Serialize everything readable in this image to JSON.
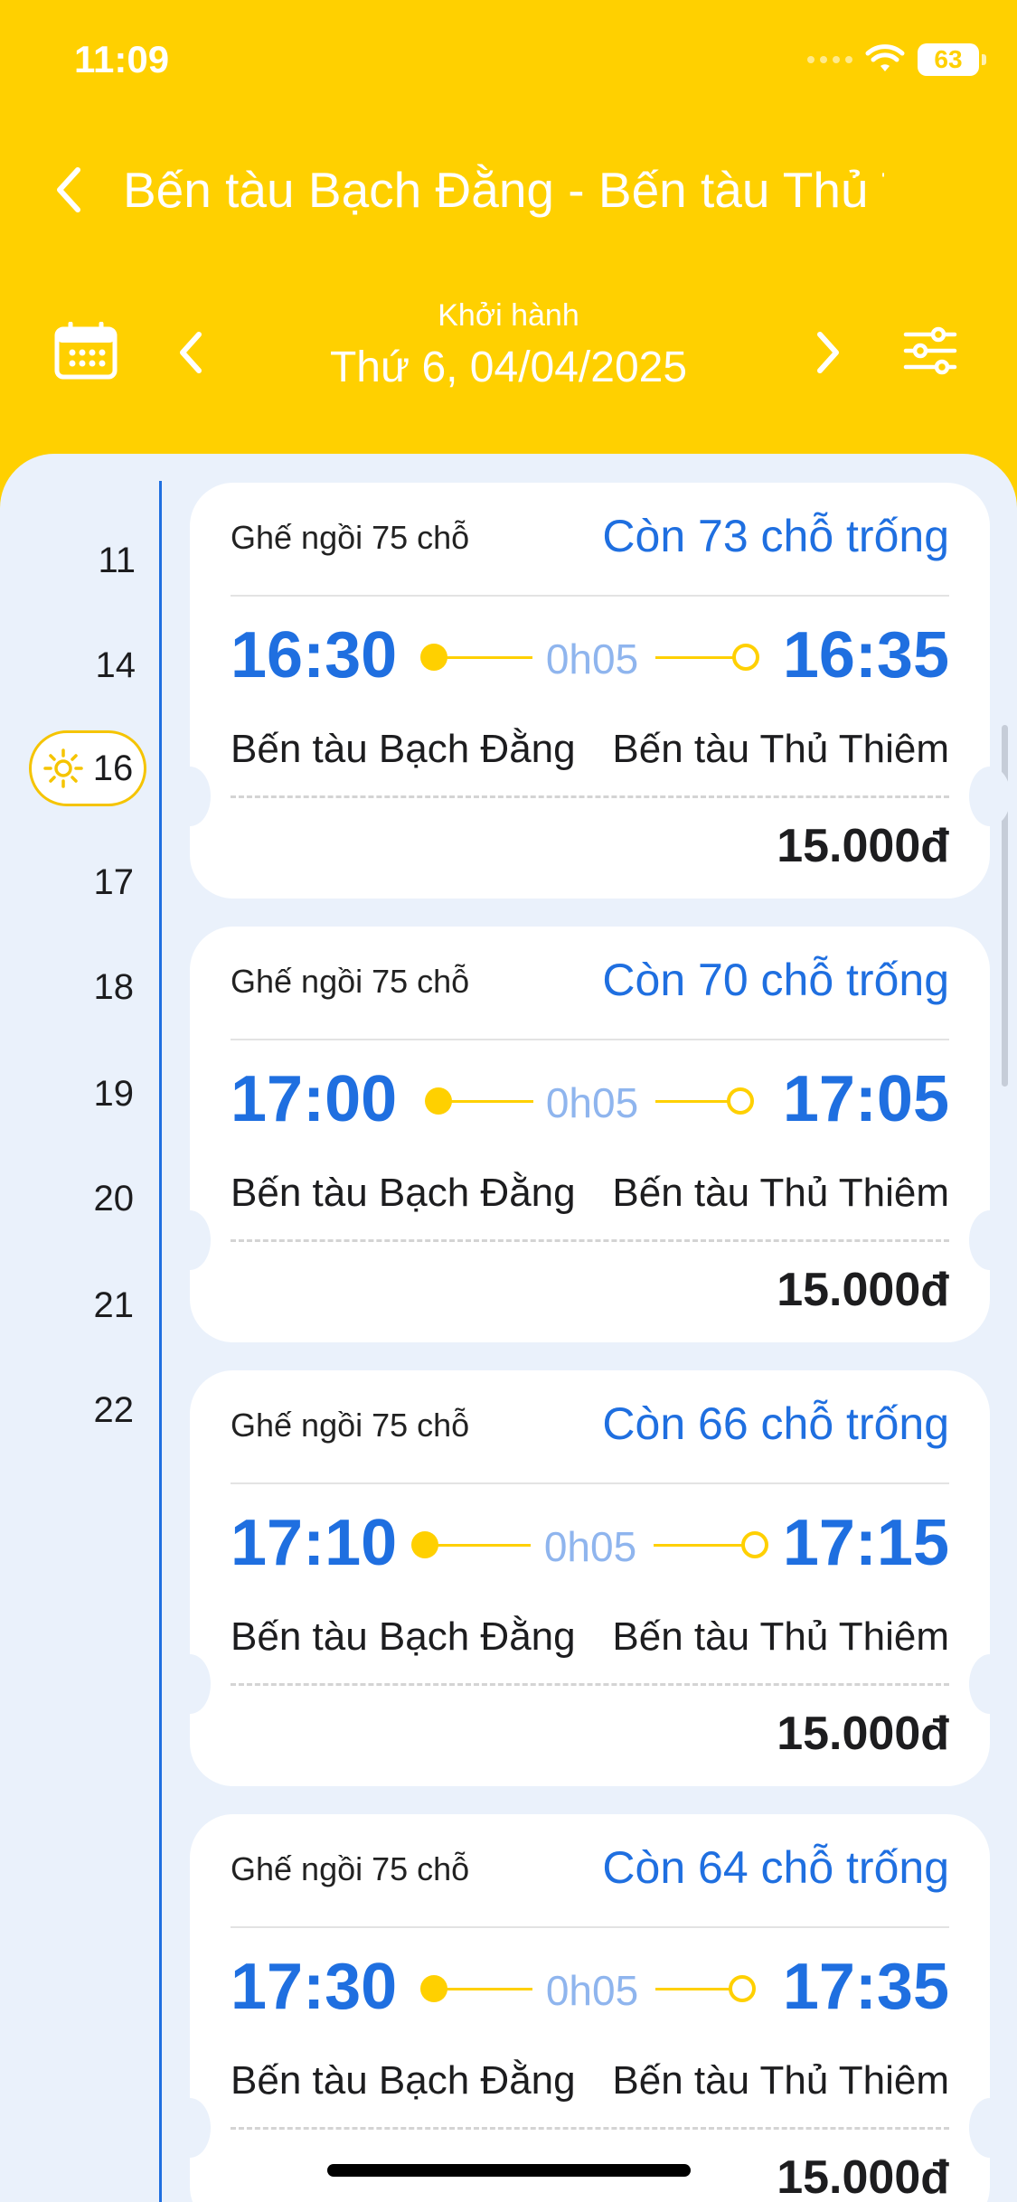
{
  "status_bar": {
    "time": "11:09",
    "battery": "63"
  },
  "header": {
    "title": "Bến tàu Bạch Đằng - Bến tàu Thủ Thiêm"
  },
  "date_nav": {
    "caption": "Khởi hành",
    "date": "Thứ 6, 04/04/2025"
  },
  "timeline": {
    "hours": [
      "11",
      "14",
      "16",
      "17",
      "18",
      "19",
      "20",
      "21",
      "22"
    ],
    "active_hour": "16"
  },
  "trips": [
    {
      "seat_type": "Ghế ngồi 75 chỗ",
      "availability": "Còn 73 chỗ trống",
      "depart": "16:30",
      "arrive": "16:35",
      "duration": "0h05",
      "from": "Bến tàu Bạch Đằng",
      "to": "Bến tàu Thủ Thiêm",
      "price": "15.000đ"
    },
    {
      "seat_type": "Ghế ngồi 75 chỗ",
      "availability": "Còn 70 chỗ trống",
      "depart": "17:00",
      "arrive": "17:05",
      "duration": "0h05",
      "from": "Bến tàu Bạch Đằng",
      "to": "Bến tàu Thủ Thiêm",
      "price": "15.000đ"
    },
    {
      "seat_type": "Ghế ngồi 75 chỗ",
      "availability": "Còn 66 chỗ trống",
      "depart": "17:10",
      "arrive": "17:15",
      "duration": "0h05",
      "from": "Bến tàu Bạch Đằng",
      "to": "Bến tàu Thủ Thiêm",
      "price": "15.000đ"
    },
    {
      "seat_type": "Ghế ngồi 75 chỗ",
      "availability": "Còn 64 chỗ trống",
      "depart": "17:30",
      "arrive": "17:35",
      "duration": "0h05",
      "from": "Bến tàu Bạch Đằng",
      "to": "Bến tàu Thủ Thiêm",
      "price": "15.000đ"
    }
  ],
  "colors": {
    "brand_yellow": "#FFD000",
    "accent_blue": "#1F6FE0",
    "panel_bg": "#EAF1FB"
  },
  "icons": {
    "back": "chevron-left-icon",
    "calendar": "calendar-icon",
    "prev": "chevron-left-icon",
    "next": "chevron-right-icon",
    "filter": "sliders-icon",
    "sun": "sun-icon"
  }
}
